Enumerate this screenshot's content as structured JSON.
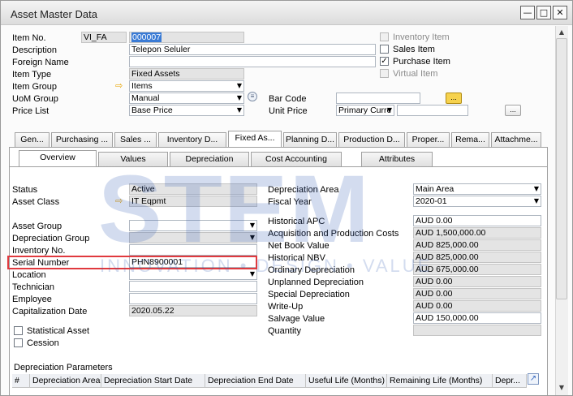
{
  "window": {
    "title": "Asset Master Data"
  },
  "header": {
    "item_no_label": "Item No.",
    "item_no_series": "VI_FA",
    "item_no_value": "000007",
    "description_label": "Description",
    "description_value": "Telepon Seluler",
    "foreign_name_label": "Foreign Name",
    "foreign_name_value": "",
    "item_type_label": "Item Type",
    "item_type_value": "Fixed Assets",
    "item_group_label": "Item Group",
    "item_group_value": "Items",
    "uom_group_label": "UoM Group",
    "uom_group_value": "Manual",
    "price_list_label": "Price List",
    "price_list_value": "Base Price",
    "bar_code_label": "Bar Code",
    "bar_code_value": "",
    "unit_price_label": "Unit Price",
    "unit_price_list": "Primary Curre",
    "unit_price_value": "",
    "inventory_item_label": "Inventory Item",
    "sales_item_label": "Sales Item",
    "purchase_item_label": "Purchase Item",
    "virtual_item_label": "Virtual Item",
    "dots": "..."
  },
  "tabs": [
    {
      "label": "Gen..."
    },
    {
      "label": "Purchasing ..."
    },
    {
      "label": "Sales ..."
    },
    {
      "label": "Inventory D..."
    },
    {
      "label": "Fixed As..."
    },
    {
      "label": "Planning D..."
    },
    {
      "label": "Production D..."
    },
    {
      "label": "Proper..."
    },
    {
      "label": "Rema..."
    },
    {
      "label": "Attachme..."
    }
  ],
  "subtabs": [
    {
      "label": "Overview"
    },
    {
      "label": "Values"
    },
    {
      "label": "Depreciation"
    },
    {
      "label": "Cost Accounting"
    },
    {
      "label": "Attributes"
    }
  ],
  "left": {
    "status_label": "Status",
    "status_value": "Active",
    "asset_class_label": "Asset Class",
    "asset_class_value": "IT Eqpmt",
    "asset_group_label": "Asset Group",
    "asset_group_value": "",
    "depreciation_group_label": "Depreciation Group",
    "depreciation_group_value": "",
    "inventory_no_label": "Inventory No.",
    "inventory_no_value": "",
    "serial_number_label": "Serial Number",
    "serial_number_value": "PHN8900001",
    "location_label": "Location",
    "location_value": "",
    "technician_label": "Technician",
    "technician_value": "",
    "employee_label": "Employee",
    "employee_value": "",
    "capitalization_date_label": "Capitalization Date",
    "capitalization_date_value": "2020.05.22",
    "statistical_asset_label": "Statistical Asset",
    "cession_label": "Cession"
  },
  "right": {
    "depreciation_area_label": "Depreciation Area",
    "depreciation_area_value": "Main Area",
    "fiscal_year_label": "Fiscal Year",
    "fiscal_year_value": "2020-01",
    "historical_apc_label": "Historical APC",
    "historical_apc_value": "AUD 0.00",
    "acq_prod_costs_label": "Acquisition and Production Costs",
    "acq_prod_costs_value": "AUD 1,500,000.00",
    "net_book_value_label": "Net Book Value",
    "net_book_value_value": "AUD 825,000.00",
    "historical_nbv_label": "Historical NBV",
    "historical_nbv_value": "AUD 825,000.00",
    "ordinary_depreciation_label": "Ordinary Depreciation",
    "ordinary_depreciation_value": "AUD 675,000.00",
    "unplanned_depreciation_label": "Unplanned Depreciation",
    "unplanned_depreciation_value": "AUD 0.00",
    "special_depreciation_label": "Special Depreciation",
    "special_depreciation_value": "AUD 0.00",
    "write_up_label": "Write-Up",
    "write_up_value": "AUD 0.00",
    "salvage_value_label": "Salvage Value",
    "salvage_value_value": "AUD 150,000.00",
    "quantity_label": "Quantity",
    "quantity_value": ""
  },
  "dep_params": {
    "title": "Depreciation Parameters",
    "columns": [
      "#",
      "Depreciation Area",
      "Depreciation Start Date",
      "Depreciation End Date",
      "Useful Life (Months)",
      "Remaining Life (Months)",
      "Depr..."
    ]
  },
  "watermark": {
    "big": "STEM",
    "small": "INNOVATION • DESIGN • VALUE"
  },
  "colors": {
    "accent": "#e0393e",
    "selected_text_bg": "#3a7bd5",
    "link_arrow": "#e8a400"
  }
}
